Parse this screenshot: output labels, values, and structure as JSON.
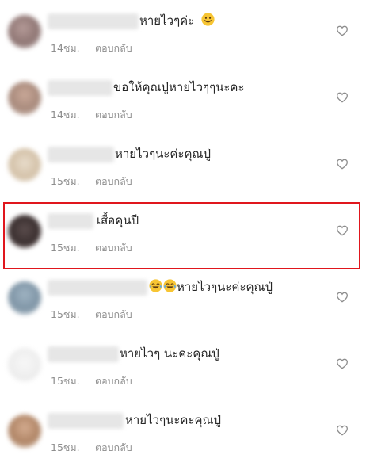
{
  "comments": [
    {
      "text": "หายไวๆค่ะ",
      "time": "14ชม.",
      "reply": "ตอบกลับ",
      "emoji": "smile"
    },
    {
      "text": "ขอให้คุณปู่หายไวๆๆนะคะ",
      "time": "14ชม.",
      "reply": "ตอบกลับ"
    },
    {
      "text": "หายไวๆนะค่ะคุณปู่",
      "time": "15ชม.",
      "reply": "ตอบกลับ"
    },
    {
      "text": "เสื้อคุนปี",
      "time": "15ชม.",
      "reply": "ตอบกลับ"
    },
    {
      "text": "หายไวๆนะค่ะคุณปู่",
      "time": "15ชม.",
      "reply": "ตอบกลับ",
      "emoji": "laugh"
    },
    {
      "text": "หายไวๆ นะคะคุณปู่",
      "time": "15ชม.",
      "reply": "ตอบกลับ"
    },
    {
      "text": "หายไวๆนะคะคุณปู่",
      "time": "15ชม.",
      "reply": "ตอบกลับ"
    }
  ],
  "icons": {
    "like": "heart-outline-icon",
    "emoji_smile": "smiling-face-emoji",
    "emoji_laugh": "tears-of-joy-emoji"
  },
  "colors": {
    "text": "#262626",
    "meta": "#8e8e8e",
    "highlight": "#e0161d",
    "emoji": "#f7c533"
  }
}
